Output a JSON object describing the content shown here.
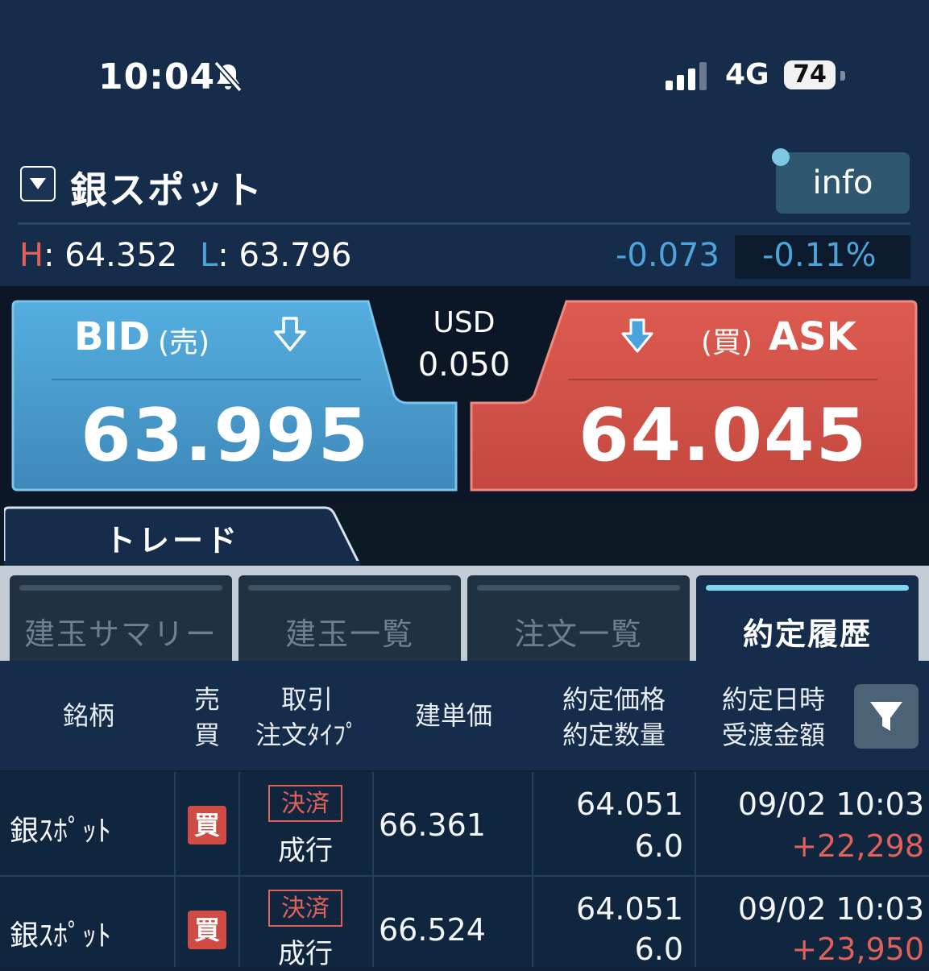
{
  "status_bar": {
    "time": "10:04",
    "network": "4G",
    "battery": "74"
  },
  "header": {
    "symbol": "銀スポット",
    "info_label": "info"
  },
  "stats": {
    "high_letter": "H",
    "high_value": ": 64.352",
    "low_letter": "L",
    "low_value": ": 63.796",
    "change": "-0.073",
    "change_pct": "-0.11%"
  },
  "quote": {
    "bid_label": "BID",
    "bid_sub": "(売)",
    "bid_price": "63.995",
    "ask_label": "ASK",
    "ask_sub": "(買)",
    "ask_price": "64.045",
    "spread_currency": "USD",
    "spread_value": "0.050",
    "colors": {
      "bid": "#4a9fd0",
      "ask": "#d5554b"
    }
  },
  "trade_tab": "トレード",
  "subtabs": [
    {
      "label": "建玉サマリー",
      "active": false
    },
    {
      "label": "建玉一覧",
      "active": false
    },
    {
      "label": "注文一覧",
      "active": false
    },
    {
      "label": "約定履歴",
      "active": true
    }
  ],
  "table": {
    "headers": {
      "symbol": "銘柄",
      "side_1": "売",
      "side_2": "買",
      "type_1": "取引",
      "type_2": "注文ﾀｲﾌﾟ",
      "open_price": "建単価",
      "exec_1": "約定価格",
      "exec_2": "約定数量",
      "date_1": "約定日時",
      "date_2": "受渡金額"
    },
    "rows": [
      {
        "symbol": "銀ｽﾎﾟｯﾄ",
        "side": "買",
        "trade": "決済",
        "order_type": "成行",
        "open_price": "66.361",
        "exec_price": "64.051",
        "exec_qty": "6.0",
        "datetime": "09/02 10:03",
        "amount": "+22,298"
      },
      {
        "symbol": "銀ｽﾎﾟｯﾄ",
        "side": "買",
        "trade": "決済",
        "order_type": "成行",
        "open_price": "66.524",
        "exec_price": "64.051",
        "exec_qty": "6.0",
        "datetime": "09/02 10:03",
        "amount": "+23,950"
      }
    ]
  }
}
